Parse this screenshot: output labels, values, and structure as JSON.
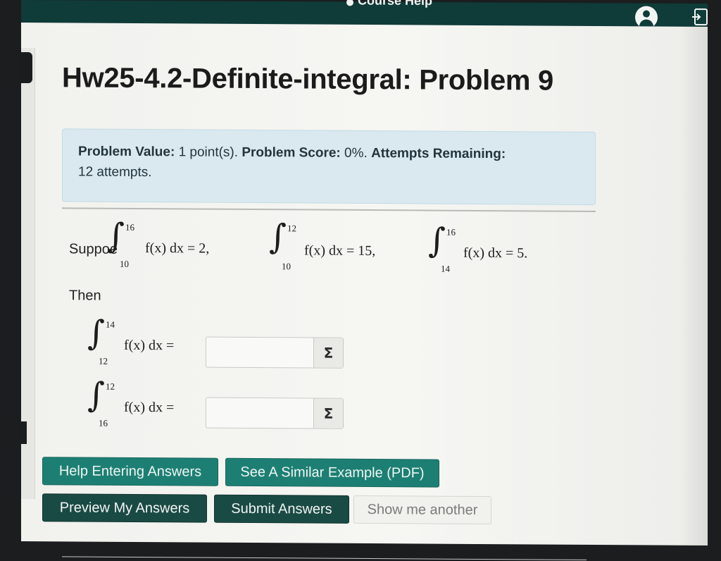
{
  "topbar": {
    "help_label": "Course Help"
  },
  "page": {
    "title": "Hw25-4.2-Definite-integral: Problem 9"
  },
  "info": {
    "value_label": "Problem Value:",
    "value_text": "1 point(s).",
    "score_label": "Problem Score:",
    "score_text": "0%.",
    "attempts_label": "Attempts Remaining:",
    "attempts_text": "12 attempts."
  },
  "problem": {
    "suppose_label": "Suppoe",
    "then_label": "Then",
    "givens": [
      {
        "lower": "10",
        "upper": "16",
        "expr": "f(x) dx = 2,"
      },
      {
        "lower": "10",
        "upper": "12",
        "expr": "f(x) dx = 15,"
      },
      {
        "lower": "14",
        "upper": "16",
        "expr": "f(x) dx = 5."
      }
    ],
    "questions": [
      {
        "lower": "12",
        "upper": "14",
        "expr": "f(x) dx =",
        "value": "",
        "placeholder": ""
      },
      {
        "lower": "16",
        "upper": "12",
        "expr": "f(x) dx =",
        "value": "",
        "placeholder": ""
      }
    ],
    "sigma_symbol": "Σ"
  },
  "buttons": {
    "help_entering": "Help Entering Answers",
    "similar_example": "See A Similar Example (PDF)",
    "preview": "Preview My Answers",
    "submit": "Submit Answers",
    "show_another": "Show me another"
  }
}
